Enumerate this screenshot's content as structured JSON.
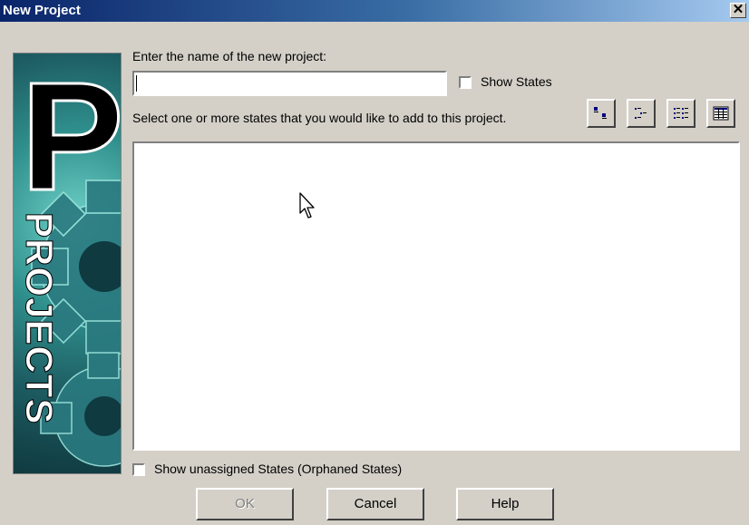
{
  "window": {
    "title": "New Project",
    "close_glyph": "✕"
  },
  "banner": {
    "letter": "P",
    "word": "PROJECTS",
    "icon": "gear-icon"
  },
  "form": {
    "name_prompt": "Enter the name of the new project:",
    "name_value": "",
    "show_states_label": "Show States",
    "states_prompt": "Select one or more states that you would like to add to this project.",
    "orphaned_label": "Show unassigned States (Orphaned States)"
  },
  "toolbar": [
    {
      "icon": "large-icons-view-icon"
    },
    {
      "icon": "small-icons-view-icon"
    },
    {
      "icon": "list-view-icon"
    },
    {
      "icon": "details-view-icon"
    }
  ],
  "buttons": {
    "ok": "OK",
    "cancel": "Cancel",
    "help": "Help"
  }
}
